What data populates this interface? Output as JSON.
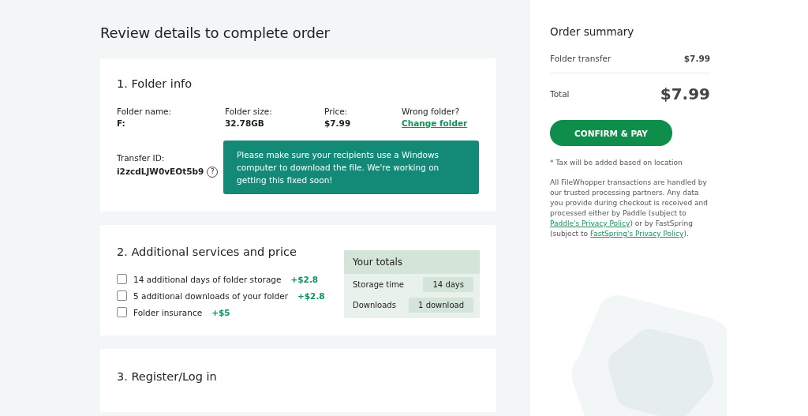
{
  "page_title": "Review details to complete order",
  "folder_info": {
    "title": "1. Folder info",
    "fields": [
      {
        "label": "Folder name:",
        "value": "F:"
      },
      {
        "label": "Folder size:",
        "value": "32.78GB"
      },
      {
        "label": "Price:",
        "value": "$7.99"
      }
    ],
    "wrong_folder": {
      "label": "Wrong folder?",
      "link": "Change folder"
    },
    "transfer_id": {
      "label": "Transfer ID:",
      "value": "i2zcdLJW0vEOt5b9",
      "help": "?"
    },
    "notice": "Please make sure your recipients use a Windows computer to download the file. We're working on getting this fixed soon!"
  },
  "services": {
    "title": "2. Additional services and price",
    "options": [
      {
        "label": "14 additional days of folder storage",
        "price": "+$2.8",
        "checked": false
      },
      {
        "label": "5 additional downloads of your folder",
        "price": "+$2.8",
        "checked": false
      },
      {
        "label": "Folder insurance",
        "price": "+$5",
        "checked": false
      }
    ],
    "totals": {
      "title": "Your totals",
      "rows": [
        {
          "label": "Storage time",
          "value": "14 days"
        },
        {
          "label": "Downloads",
          "value": "1 download"
        }
      ]
    }
  },
  "register": {
    "title": "3. Register/Log in"
  },
  "summary": {
    "title": "Order summary",
    "lines": [
      {
        "label": "Folder transfer",
        "value": "$7.99"
      }
    ],
    "total": {
      "label": "Total",
      "value": "$7.99"
    },
    "button": "CONFIRM & PAY",
    "tax_note": "* Tax will be added based on location",
    "disclaimer": [
      {
        "kind": "text",
        "text": "All FileWhopper transactions are handled by our trusted processing partners. Any data you provide during checkout is received and processed either by Paddle (subject to "
      },
      {
        "kind": "link",
        "text": "Paddle's Privacy Policy"
      },
      {
        "kind": "text",
        "text": ") or by FastSpring (subject to "
      },
      {
        "kind": "link",
        "text": "FastSpring's Privacy Policy"
      },
      {
        "kind": "text",
        "text": ")."
      }
    ]
  }
}
